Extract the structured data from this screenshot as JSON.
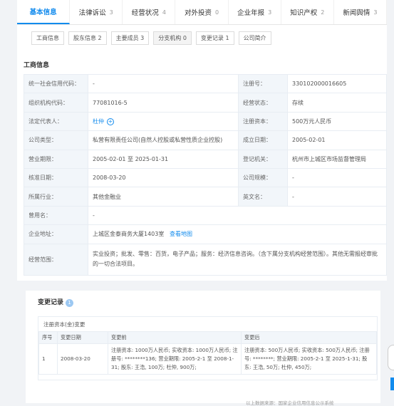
{
  "tabs": [
    {
      "label": "基本信息",
      "count": ""
    },
    {
      "label": "法律诉讼",
      "count": "3"
    },
    {
      "label": "经营状况",
      "count": "4"
    },
    {
      "label": "对外投资",
      "count": "0"
    },
    {
      "label": "企业年报",
      "count": "3"
    },
    {
      "label": "知识产权",
      "count": "2"
    },
    {
      "label": "新闻舆情",
      "count": "3"
    }
  ],
  "subtabs": [
    "工商信息",
    "股东信息 2",
    "主要成员 3",
    "分支机构 0",
    "变更记录 1",
    "公司简介"
  ],
  "section_title": "工商信息",
  "info": {
    "credit_code_label": "统一社会信用代码：",
    "credit_code": "-",
    "reg_no_label": "注册号：",
    "reg_no": "330102000016605",
    "org_code_label": "组织机构代码：",
    "org_code": "77081016-5",
    "status_label": "经营状态：",
    "status": "存续",
    "legal_rep_label": "法定代表人：",
    "legal_rep": "杜仲",
    "capital_label": "注册资本：",
    "capital": "500万元人民币",
    "type_label": "公司类型：",
    "type": "私营有限责任公司(自然人控股或私营性质企业控股)",
    "found_label": "成立日期：",
    "found": "2005-02-01",
    "term_label": "营业期限：",
    "term": "2005-02-01 至 2025-01-31",
    "authority_label": "登记机关：",
    "authority": "杭州市上城区市场监督管理局",
    "approve_label": "核准日期：",
    "approve": "2008-03-20",
    "scale_label": "公司规模：",
    "scale": "-",
    "industry_label": "所属行业：",
    "industry": "其他金融业",
    "en_name_label": "英文名：",
    "en_name": "-",
    "used_name_label": "曾用名：",
    "used_name": "-",
    "address_label": "企业地址：",
    "address": "上城区金泰商务大厦1403室",
    "map_link": "查看地图",
    "scope_label": "经营范围：",
    "scope": "实业投资；批发、零售：百货，电子产品；服务：经济信息咨询。（含下属分支机构经营范围）。其他无需报经审批的一切合法项目。"
  },
  "changes": {
    "title": "变更记录",
    "count": "1",
    "category": "注册资本(金)变更",
    "headers": [
      "序号",
      "变更日期",
      "变更前",
      "变更后"
    ],
    "rows": [
      {
        "no": "1",
        "date": "2008-03-20",
        "before": "注册资本: 1000万人民币; 实收资本: 1000万人民币; 注册号: ********136; 营业期限: 2005-2-1 至 2008-1-31; 股东: 王浩, 100万; 杜仲, 900万;",
        "after": "注册资本: 500万人民币; 实收资本: 500万人民币; 注册号: ********; 营业期限: 2005-2-1 至 2025-1-31; 股东: 王浩, 50万; 杜仲, 450万;"
      }
    ]
  },
  "footer_text": "以上数据来源：国家企业信用信息公示系统"
}
